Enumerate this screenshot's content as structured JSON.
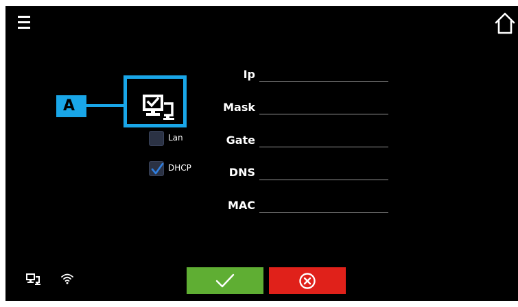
{
  "header": {
    "menu_icon": "menu-icon",
    "home_icon": "home-icon"
  },
  "callout": {
    "label": "A"
  },
  "network": {
    "icon": "network-computers-icon",
    "options": [
      {
        "label": "Lan",
        "checked": false
      },
      {
        "label": "DHCP",
        "checked": true
      }
    ],
    "fields": [
      {
        "label": "Ip",
        "value": ""
      },
      {
        "label": "Mask",
        "value": ""
      },
      {
        "label": "Gate",
        "value": ""
      },
      {
        "label": "DNS",
        "value": ""
      },
      {
        "label": "MAC",
        "value": ""
      }
    ]
  },
  "status_bar": {
    "icons": [
      "network-status-icon",
      "wifi-icon"
    ]
  },
  "actions": {
    "confirm_icon": "checkmark-icon",
    "cancel_icon": "cancel-circle-x-icon"
  },
  "colors": {
    "background": "#000000",
    "callout": "#19a6e8",
    "confirm": "#5fae33",
    "cancel": "#e0211a",
    "checkbox_check": "#2f7fe0"
  }
}
